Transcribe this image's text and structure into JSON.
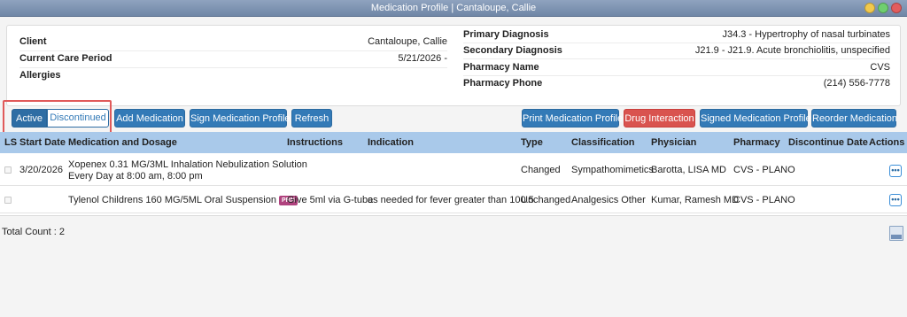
{
  "window": {
    "title": "Medication Profile | Cantaloupe, Callie"
  },
  "info": {
    "left": [
      {
        "label": "Client",
        "value": "Cantaloupe, Callie"
      },
      {
        "label": "Current Care Period",
        "value": "5/21/2026 -"
      },
      {
        "label": "Allergies",
        "value": ""
      }
    ],
    "right": [
      {
        "label": "Primary Diagnosis",
        "value": "J34.3 - Hypertrophy of nasal turbinates"
      },
      {
        "label": "Secondary Diagnosis",
        "value": "J21.9 - J21.9. Acute bronchiolitis, unspecified"
      },
      {
        "label": "Pharmacy Name",
        "value": "CVS"
      },
      {
        "label": "Pharmacy Phone",
        "value": "(214) 556-7778"
      }
    ]
  },
  "toolbar": {
    "active": "Active",
    "discontinued": "Discontinued",
    "add_medication": "Add Medication",
    "sign_profile": "Sign Medication Profile",
    "refresh": "Refresh",
    "print_profile": "Print Medication Profile",
    "drug_interaction": "Drug Interaction",
    "signed_profiles": "Signed Medication Profiles",
    "reorder": "Reorder Medication"
  },
  "table": {
    "headers": {
      "ls": "LS",
      "start_date": "Start Date",
      "medication": "Medication and Dosage",
      "instructions": "Instructions",
      "indication": "Indication",
      "type": "Type",
      "classification": "Classification",
      "physician": "Physician",
      "pharmacy": "Pharmacy",
      "discontinue_date": "Discontinue Date",
      "actions": "Actions"
    },
    "rows": [
      {
        "start_date": "3/20/2026",
        "medication": "Xopenex 0.31 MG/3ML Inhalation Nebulization Solution",
        "schedule": "Every Day at 8:00 am, 8:00 pm",
        "instructions": "",
        "indication": "",
        "type": "Changed",
        "classification": "Sympathomimetics",
        "physician": "Barotta, LISA MD",
        "pharmacy": "CVS - PLANO",
        "discontinue_date": "",
        "action": "•••"
      },
      {
        "start_date": "",
        "medication": "Tylenol Childrens 160 MG/5ML Oral Suspension",
        "badge": "PRN",
        "instructions": "Give 5ml via G-tube",
        "indication": "as needed for fever greater than 100.5",
        "type": "Unchanged",
        "classification": "Analgesics Other",
        "physician": "Kumar, Ramesh MD",
        "pharmacy": "CVS - PLANO",
        "discontinue_date": "",
        "action": "•••"
      }
    ]
  },
  "footer": {
    "total_count": "Total Count : 2"
  },
  "colors": {
    "primary": "#337ab7",
    "danger": "#d9534f",
    "header": "#a9c9ea",
    "highlight": "#e05a5a",
    "prn": "#b0427e"
  }
}
